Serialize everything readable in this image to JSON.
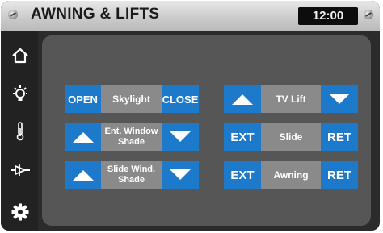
{
  "header": {
    "title": "AWNING & LIFTS",
    "time": "12:00"
  },
  "sidebar": {
    "items": [
      "home-icon",
      "light-bulb-icon",
      "thermometer-icon",
      "generator-icon",
      "gear-icon"
    ]
  },
  "controls": {
    "skylight": {
      "left": "OPEN",
      "label": "Skylight",
      "right": "CLOSE"
    },
    "ent_window_shade": {
      "label_line1": "Ent. Window",
      "label_line2": "Shade",
      "left_icon": "up-arrow-icon",
      "right_icon": "down-arrow-icon"
    },
    "slide_wind_shade": {
      "label_line1": "Slide Wind.",
      "label_line2": "Shade",
      "left_icon": "up-arrow-icon",
      "right_icon": "down-arrow-icon"
    },
    "tv_lift": {
      "label": "TV Lift",
      "left_icon": "up-arrow-icon",
      "right_icon": "down-arrow-icon"
    },
    "slide": {
      "left": "EXT",
      "label": "Slide",
      "right": "RET"
    },
    "awning": {
      "left": "EXT",
      "label": "Awning",
      "right": "RET"
    }
  },
  "colors": {
    "button_blue": "#1d79c9",
    "label_gray": "#8a8a8a",
    "panel_gray": "#565656"
  }
}
